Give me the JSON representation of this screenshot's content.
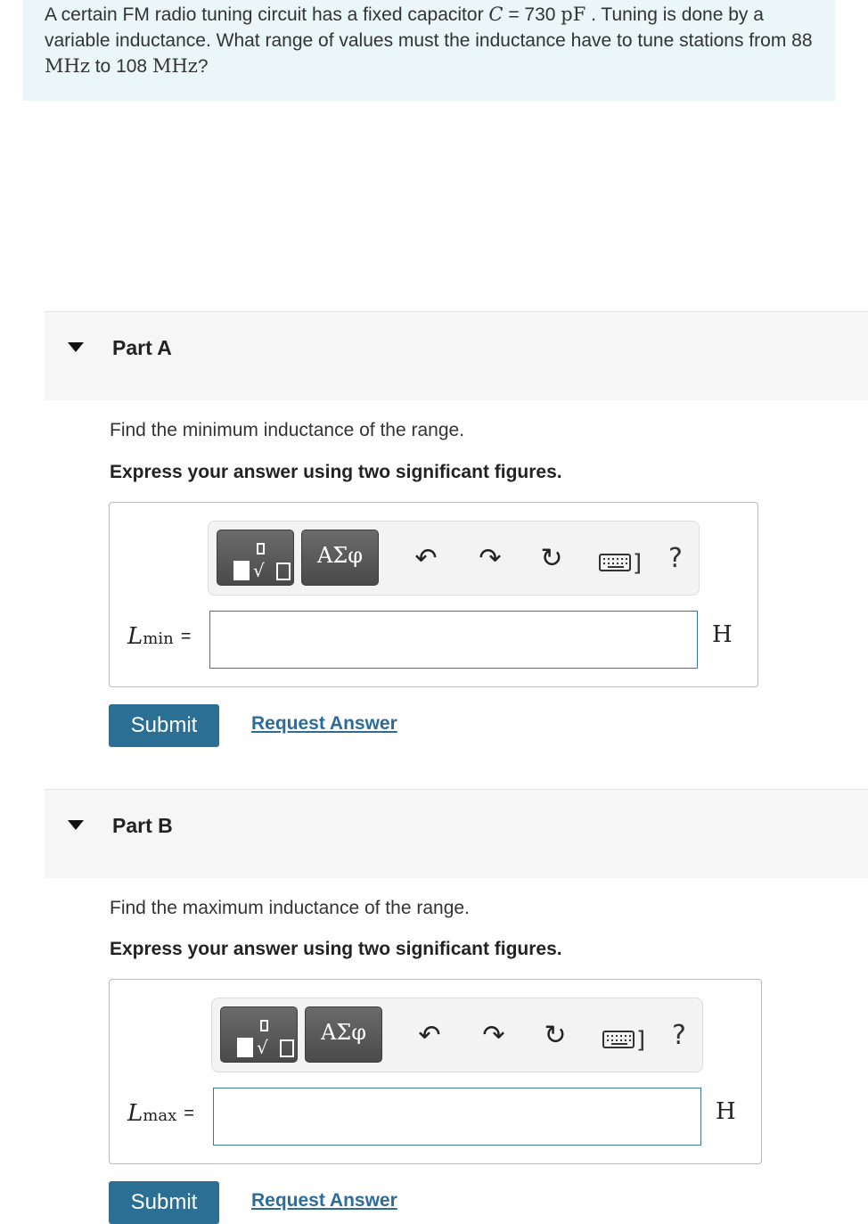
{
  "problem": {
    "text_1": "A certain FM radio tuning circuit has a fixed capacitor ",
    "cap_symbol": "C",
    "equals": " = 730 ",
    "cap_unit": "pF",
    "text_2": " . Tuning is done by a variable inductance. What range of values must the inductance have to tune stations from 88 ",
    "freq_unit_1": "MHz",
    "text_3": " to 108 ",
    "freq_unit_2": "MHz",
    "text_4": "?"
  },
  "parts": [
    {
      "title": "Part A",
      "prompt": "Find the minimum inductance of the range.",
      "instruction": "Express your answer using two significant figures.",
      "var_symbol": "L",
      "var_sub": "min",
      "equals": "=",
      "input_value": "",
      "unit": "H",
      "submit_label": "Submit",
      "request_label": "Request Answer"
    },
    {
      "title": "Part B",
      "prompt": "Find the maximum inductance of the range.",
      "instruction": "Express your answer using two significant figures.",
      "var_symbol": "L",
      "var_sub": "max",
      "equals": "=",
      "input_value": "",
      "unit": "H",
      "submit_label": "Submit",
      "request_label": "Request Answer"
    }
  ],
  "toolbar": {
    "greek_label": "ΑΣφ",
    "help_label": "?"
  },
  "icons": [
    "caret-down-icon",
    "templates-icon",
    "undo-icon",
    "redo-icon",
    "reset-icon",
    "keyboard-icon",
    "help-icon"
  ]
}
